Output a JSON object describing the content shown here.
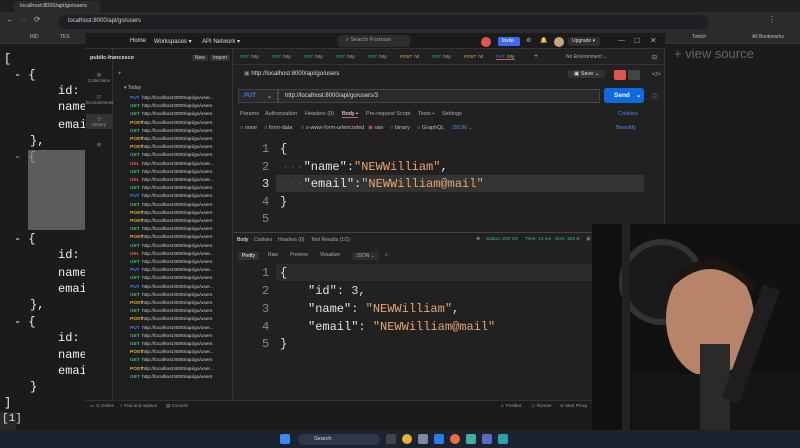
{
  "browser": {
    "tab_title": "localhost:8000/api/go/users",
    "url": "localhost:8000/api/go/users",
    "bookmarks": [
      "IND",
      "TES",
      "Twitch",
      "All Bookmarks"
    ]
  },
  "background_json": {
    "lines": [
      "[",
      "- {",
      "id:",
      "name",
      "emai",
      "},",
      "- {",
      "id:",
      "name",
      "emai",
      "},",
      "- {",
      "id:",
      "name",
      "emai",
      "}",
      "]"
    ],
    "view_source": "+ view source",
    "terminal": "[1]"
  },
  "postman": {
    "nav": [
      "Home",
      "Workspaces ▾",
      "API Network ▾"
    ],
    "search_placeholder": "Search Postman",
    "invite_label": "Invite",
    "upgrade_label": "Upgrade ▾",
    "workspace_name": "public-francesco",
    "new_label": "New",
    "import_label": "Import",
    "rail": [
      "Collections",
      "Environments",
      "History"
    ],
    "history_group": "Today",
    "history": [
      {
        "m": "PUT",
        "u": "http://localhost:8000/api/go/user..."
      },
      {
        "m": "GET",
        "u": "http://localhost:8000/api/go/users"
      },
      {
        "m": "GET",
        "u": "http://localhost:8000/api/go/users"
      },
      {
        "m": "POST",
        "u": "http://localhost:8000/api/go/users"
      },
      {
        "m": "GET",
        "u": "http://localhost:8000/api/go/users"
      },
      {
        "m": "POST",
        "u": "http://localhost:8000/api/go/users"
      },
      {
        "m": "POST",
        "u": "http://localhost:8000/api/go/users"
      },
      {
        "m": "GET",
        "u": "http://localhost:8000/api/go/users"
      },
      {
        "m": "DEL",
        "u": "http://localhost:8000/api/go/user..."
      },
      {
        "m": "GET",
        "u": "http://localhost:8000/api/go/users"
      },
      {
        "m": "DEL",
        "u": "http://localhost:8000/api/go/user..."
      },
      {
        "m": "GET",
        "u": "http://localhost:8000/api/go/users"
      },
      {
        "m": "PUT",
        "u": "http://localhost:8000/api/go/users"
      },
      {
        "m": "GET",
        "u": "http://localhost:8000/api/go/users"
      },
      {
        "m": "POST",
        "u": "http://localhost:8000/api/go/users"
      },
      {
        "m": "POST",
        "u": "http://localhost:8000/api/go/users"
      },
      {
        "m": "GET",
        "u": "http://localhost:8000/api/go/users"
      },
      {
        "m": "POST",
        "u": "http://localhost:8000/api/go/users"
      },
      {
        "m": "GET",
        "u": "http://localhost:8000/api/go/users"
      },
      {
        "m": "DEL",
        "u": "http://localhost:8000/api/go/user..."
      },
      {
        "m": "GET",
        "u": "http://localhost:8000/api/go/users"
      },
      {
        "m": "PUT",
        "u": "http://localhost:8000/api/go/user..."
      },
      {
        "m": "GET",
        "u": "http://localhost:8000/api/go/users"
      },
      {
        "m": "PUT",
        "u": "http://localhost:8000/api/go/user..."
      },
      {
        "m": "GET",
        "u": "http://localhost:8000/api/go/users"
      },
      {
        "m": "POST",
        "u": "http://localhost:8000/api/go/users"
      },
      {
        "m": "GET",
        "u": "http://localhost:8000/api/go/users"
      },
      {
        "m": "POST",
        "u": "http://localhost:8000/api/go/users"
      },
      {
        "m": "PUT",
        "u": "http://localhost:8000/api/go/user..."
      },
      {
        "m": "GET",
        "u": "http://localhost:8000/api/go/users"
      },
      {
        "m": "GET",
        "u": "http://localhost:8000/api/go/users"
      },
      {
        "m": "POST",
        "u": "http://localhost:8000/api/go/user..."
      },
      {
        "m": "GET",
        "u": "http://localhost:8000/api/go/users"
      },
      {
        "m": "POST",
        "u": "http://localhost:8000/api/go/user..."
      },
      {
        "m": "GET",
        "u": "http://localhost:8000/api/go/users"
      }
    ],
    "req_tabs": [
      {
        "m": "GET",
        "l": "http"
      },
      {
        "m": "GET",
        "l": "http"
      },
      {
        "m": "GET",
        "l": "http"
      },
      {
        "m": "GET",
        "l": "http"
      },
      {
        "m": "GET",
        "l": "http"
      },
      {
        "m": "POST",
        "l": "htt"
      },
      {
        "m": "GET",
        "l": "http"
      },
      {
        "m": "POST",
        "l": "htt"
      },
      {
        "m": "PUT",
        "l": "http"
      }
    ],
    "environment": "No Environment",
    "request_title": "http://localhost:8000/api/go/users",
    "save_label": "Save",
    "method": "PUT",
    "request_url": "http://localhost:8000/api/go/users/3",
    "send_label": "Send",
    "subtabs": [
      "Params",
      "Authorization",
      "Headers (9)",
      "Body •",
      "Pre-request Script",
      "Tests •",
      "Settings"
    ],
    "cookies_label": "Cookies",
    "body_options": [
      "none",
      "form-data",
      "x-www-form-urlencoded",
      "raw",
      "binary",
      "GraphQL",
      "JSON ⌄"
    ],
    "beautify_label": "Beautify",
    "request_body": {
      "lines": [
        "1",
        "2",
        "3",
        "4",
        "5"
      ],
      "open": "{",
      "name_key": "\"name\"",
      "name_val": "\"NEWWilliam\"",
      "email_key": "\"email\"",
      "email_val": "\"NEWWilliam@mail\"",
      "close": "}"
    },
    "response_tabs": [
      "Body",
      "Cookies",
      "Headers (6)",
      "Test Results (1/1)"
    ],
    "status": "Status: 200 OK",
    "time": "Time: 14 ms",
    "size": "Size: 302 B",
    "save_example": "Save as example",
    "response_views": [
      "Pretty",
      "Raw",
      "Preview",
      "Visualize",
      "JSON ⌄"
    ],
    "response_body": {
      "lines": [
        "1",
        "2",
        "3",
        "4",
        "5"
      ],
      "open": "{",
      "id_key": "\"id\"",
      "id_val": "3",
      "name_key": "\"name\"",
      "name_val": "\"NEWWilliam\"",
      "email_key": "\"email\"",
      "email_val": "\"NEWWilliam@mail\"",
      "close": "}"
    },
    "statusbar": [
      "Online",
      "Find and replace",
      "Console",
      "Postbot",
      "Runner",
      "Start Proxy",
      "Cook"
    ]
  },
  "taskbar": {
    "search_label": "Search"
  },
  "colors": {
    "get": "#2fbf71",
    "post": "#e5b42b",
    "put": "#3d7bf2",
    "del": "#e0564b",
    "send": "#0b6bdf"
  }
}
